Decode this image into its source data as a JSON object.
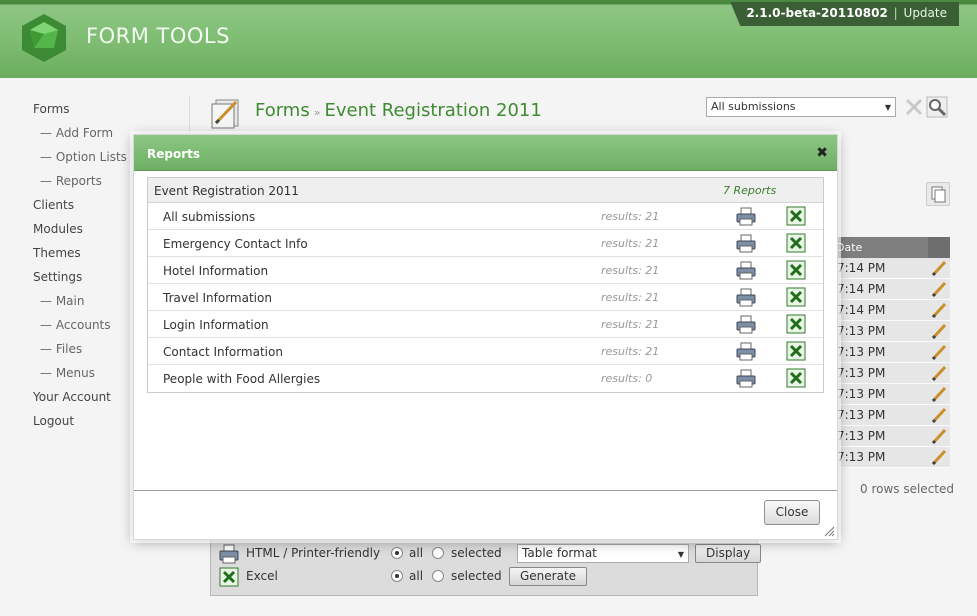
{
  "header": {
    "app_name": "FORM TOOLS",
    "version": "2.1.0-beta-20110802",
    "separator": "|",
    "update_label": "Update"
  },
  "sidebar": {
    "items": [
      {
        "label": "Forms",
        "sub": false
      },
      {
        "label": "— Add Form",
        "sub": true
      },
      {
        "label": "— Option Lists",
        "sub": true
      },
      {
        "label": "— Reports",
        "sub": true
      },
      {
        "label": "Clients",
        "sub": false
      },
      {
        "label": "Modules",
        "sub": false
      },
      {
        "label": "Themes",
        "sub": false
      },
      {
        "label": "Settings",
        "sub": false
      },
      {
        "label": "— Main",
        "sub": true
      },
      {
        "label": "— Accounts",
        "sub": true
      },
      {
        "label": "— Files",
        "sub": true
      },
      {
        "label": "— Menus",
        "sub": true
      },
      {
        "label": "Your Account",
        "sub": false
      },
      {
        "label": "Logout",
        "sub": false
      }
    ]
  },
  "page": {
    "breadcrumb_root": "Forms",
    "breadcrumb_arrow": "»",
    "form_name": "Event Registration 2011",
    "view_select_value": "All submissions",
    "date_header": "Date",
    "date_rows": [
      "7:14 PM",
      "7:14 PM",
      "7:14 PM",
      "7:13 PM",
      "7:13 PM",
      "7:13 PM",
      "7:13 PM",
      "7:13 PM",
      "7:13 PM",
      "7:13 PM"
    ],
    "rows_selected": "0 rows selected"
  },
  "export": {
    "html_label": "HTML / Printer-friendly",
    "excel_label": "Excel",
    "all_label": "all",
    "selected_label": "selected",
    "format_value": "Table format",
    "display_label": "Display",
    "generate_label": "Generate"
  },
  "modal": {
    "title": "Reports",
    "close_x": "✖",
    "form_name": "Event Registration 2011",
    "report_count": "7 Reports",
    "reports": [
      {
        "name": "All submissions",
        "results": "results: 21"
      },
      {
        "name": "Emergency Contact Info",
        "results": "results: 21"
      },
      {
        "name": "Hotel Information",
        "results": "results: 21"
      },
      {
        "name": "Travel Information",
        "results": "results: 21"
      },
      {
        "name": "Login Information",
        "results": "results: 21"
      },
      {
        "name": "Contact Information",
        "results": "results: 21"
      },
      {
        "name": "People with Food Allergies",
        "results": "results: 0"
      }
    ],
    "close_label": "Close"
  },
  "colors": {
    "brand_green": "#6aad5e",
    "title_green": "#3f8b32",
    "version_bg": "#3a5f34"
  }
}
